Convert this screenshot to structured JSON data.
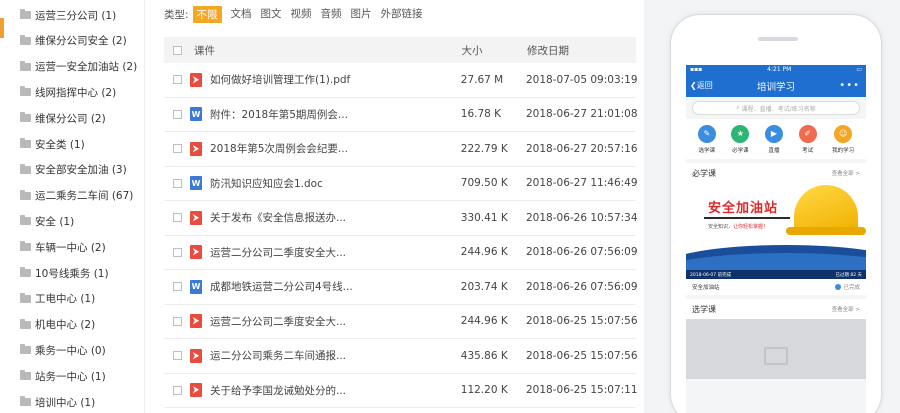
{
  "sidebar": {
    "folders": [
      "运营三分公司 (1)",
      "维保分公司安全 (2)",
      "运营一安全加油站 (2)",
      "线网指挥中心 (2)",
      "维保分公司 (2)",
      "安全类 (1)",
      "安全部安全加油 (3)",
      "运二乘务二车间 (67)",
      "安全 (1)",
      "车辆一中心 (2)",
      "10号线乘务 (1)",
      "工电中心 (1)",
      "机电中心 (2)",
      "乘务一中心 (0)",
      "站务一中心 (1)",
      "培训中心 (1)"
    ]
  },
  "filter": {
    "label": "类型:",
    "options": [
      "不限",
      "文档",
      "图文",
      "视频",
      "音频",
      "图片",
      "外部链接"
    ],
    "active_index": 0
  },
  "table": {
    "headers": {
      "name": "课件",
      "size": "大小",
      "date": "修改日期"
    },
    "rows": [
      {
        "type": "pdf",
        "name": "如何做好培训管理工作(1).pdf",
        "size": "27.67 M",
        "date": "2018-07-05 09:03:19"
      },
      {
        "type": "doc",
        "name": "附件：2018年第5期周例会...",
        "size": "16.78 K",
        "date": "2018-06-27 21:01:08"
      },
      {
        "type": "pdf",
        "name": "2018年第5次周例会会纪要...",
        "size": "222.79 K",
        "date": "2018-06-27 20:57:16"
      },
      {
        "type": "doc",
        "name": "防汛知识应知应会1.doc",
        "size": "709.50 K",
        "date": "2018-06-27 11:46:49"
      },
      {
        "type": "pdf",
        "name": "关于发布《安全信息报送办...",
        "size": "330.41 K",
        "date": "2018-06-26 10:57:34"
      },
      {
        "type": "pdf",
        "name": "运营二分公司二季度安全大...",
        "size": "244.96 K",
        "date": "2018-06-26 07:56:09"
      },
      {
        "type": "doc",
        "name": "成都地铁运营二分公司4号线...",
        "size": "203.74 K",
        "date": "2018-06-26 07:56:09"
      },
      {
        "type": "pdf",
        "name": "运营二分公司二季度安全大...",
        "size": "244.96 K",
        "date": "2018-06-25 15:07:56"
      },
      {
        "type": "pdf",
        "name": "运二分公司乘务二车间通报...",
        "size": "435.86 K",
        "date": "2018-06-25 15:07:56"
      },
      {
        "type": "pdf",
        "name": "关于给予李国龙诫勉处分的...",
        "size": "112.20 K",
        "date": "2018-06-25 15:07:11"
      }
    ]
  },
  "phone": {
    "status_time": "4:21 PM",
    "back_label": "返回",
    "title": "培训学习",
    "more": "•••",
    "search_placeholder": "课程、直播、考试/练习名称",
    "shortcuts": [
      {
        "label": "选学课",
        "color": "#3b8de0",
        "icon": "book-icon"
      },
      {
        "label": "必学课",
        "color": "#2bb673",
        "icon": "star-icon"
      },
      {
        "label": "直播",
        "color": "#3b8de0",
        "icon": "play-icon"
      },
      {
        "label": "考试",
        "color": "#f06a4e",
        "icon": "pen-icon"
      },
      {
        "label": "我的学习",
        "color": "#f5a623",
        "icon": "user-icon"
      }
    ],
    "required_section": {
      "title": "必学课",
      "more": "查看全部 >"
    },
    "banner": {
      "title": "安全加油站",
      "sub_prefix": "安全知识，",
      "sub_red": "让你轻松掌握！",
      "foot_left": "2018-06-07 前完成",
      "foot_right": "已过期 82 天"
    },
    "course": {
      "name": "安全加油站",
      "status": "已完成"
    },
    "elective_section": {
      "title": "选学课",
      "more": "查看全部 >"
    }
  }
}
